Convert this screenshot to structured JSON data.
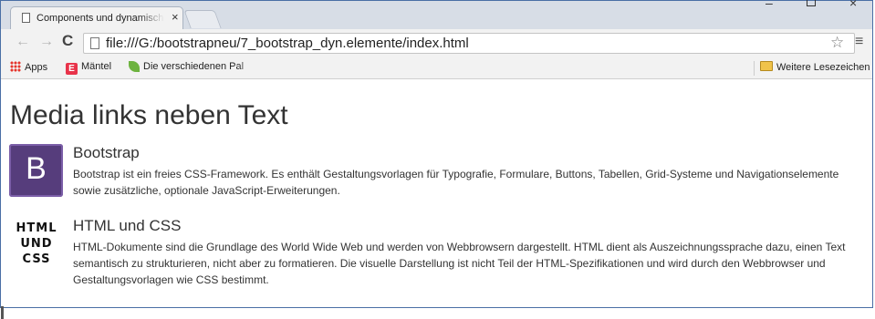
{
  "browser": {
    "tab": {
      "title": "Components und dynamische Elemente",
      "close_glyph": "×"
    },
    "window_controls": {
      "minimize": "–",
      "maximize": "□",
      "close": "×"
    },
    "toolbar": {
      "back": "←",
      "forward": "→",
      "reload": "C",
      "url": "file:///G:/bootstrapneu/7_bootstrap_dyn.elemente/index.html",
      "star": "☆",
      "menu": "≡"
    },
    "bookmarks": {
      "apps": "Apps",
      "maentel": "Mäntel",
      "maentel_icon": "E",
      "pal": "Die verschiedenen Pal",
      "weitere": "Weitere Lesezeichen"
    }
  },
  "page": {
    "title": "Media links neben Text",
    "media": [
      {
        "logo": "B",
        "heading": "Bootstrap",
        "text": "Bootstrap ist ein freies CSS-Framework. Es enthält Gestaltungsvorlagen für Typografie, Formulare, Buttons, Tabellen, Grid-Systeme und Navigationselemente sowie zusätzliche, optionale JavaScript-Erweiterungen."
      },
      {
        "logo_lines": [
          "HTML",
          "UND",
          "CSS"
        ],
        "heading": "HTML und CSS",
        "text": "HTML-Dokumente sind die Grundlage des World Wide Web und werden von Webbrowsern dargestellt. HTML dient als Auszeichnungssprache dazu, einen Text semantisch zu strukturieren, nicht aber zu formatieren. Die visuelle Darstellung ist nicht Teil der HTML-Spezifikationen und wird durch den Webbrowser und Gestaltungsvorlagen wie CSS bestimmt."
      }
    ]
  },
  "colors": {
    "bootstrap_purple": "#563d7c",
    "apps_red": "#e5352b",
    "maentel_red": "#e8334a",
    "leaf_green": "#6db33f",
    "folder_yellow": "#f0c34a"
  }
}
